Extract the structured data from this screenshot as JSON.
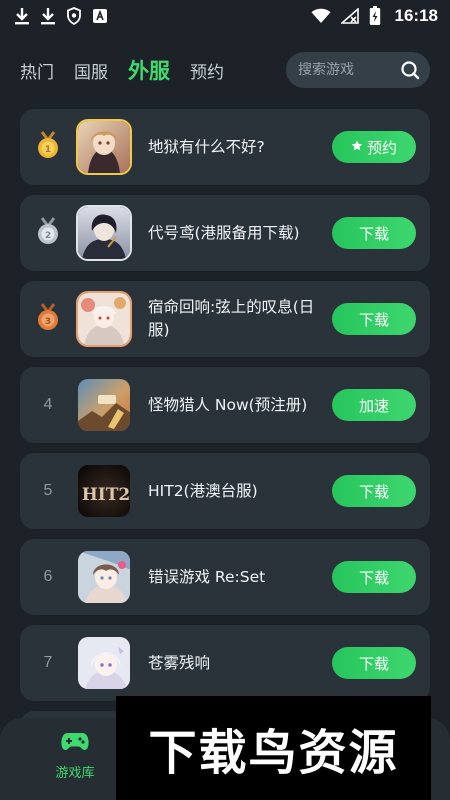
{
  "status_bar": {
    "time": "16:18",
    "icons": [
      "download-icon",
      "download-icon",
      "shield-icon",
      "a-app-icon",
      "wifi-icon",
      "no-signal-icon",
      "battery-charging-icon"
    ]
  },
  "tabs": [
    {
      "label": "热门",
      "active": false
    },
    {
      "label": "国服",
      "active": false
    },
    {
      "label": "外服",
      "active": true
    },
    {
      "label": "预约",
      "active": false
    }
  ],
  "search": {
    "placeholder": "搜索游戏"
  },
  "games": [
    {
      "rank": "",
      "medal": "gold",
      "name": "地狱有什么不好?",
      "action": "预约",
      "action_icon": "star-icon"
    },
    {
      "rank": "",
      "medal": "silver",
      "name": "代号鸢(港服备用下载)",
      "action": "下载"
    },
    {
      "rank": "",
      "medal": "bronze",
      "name": "宿命回响:弦上的叹息(日服)",
      "action": "下载"
    },
    {
      "rank": "4",
      "medal": "none",
      "name": "怪物猎人 Now(预注册)",
      "action": "加速"
    },
    {
      "rank": "5",
      "medal": "none",
      "name": "HIT2(港澳台服)",
      "action": "下载"
    },
    {
      "rank": "6",
      "medal": "none",
      "name": "错误游戏 Re:Set",
      "action": "下载"
    },
    {
      "rank": "7",
      "medal": "none",
      "name": "苍雾残响",
      "action": "下载"
    }
  ],
  "thumb_text": {
    "hit2": "HIT2"
  },
  "bottom_nav": {
    "game_library": "游戏库"
  },
  "watermark": "下载鸟资源",
  "colors": {
    "accent": "#3fd96e",
    "card": "#2a333a",
    "background": "#1c2227"
  }
}
